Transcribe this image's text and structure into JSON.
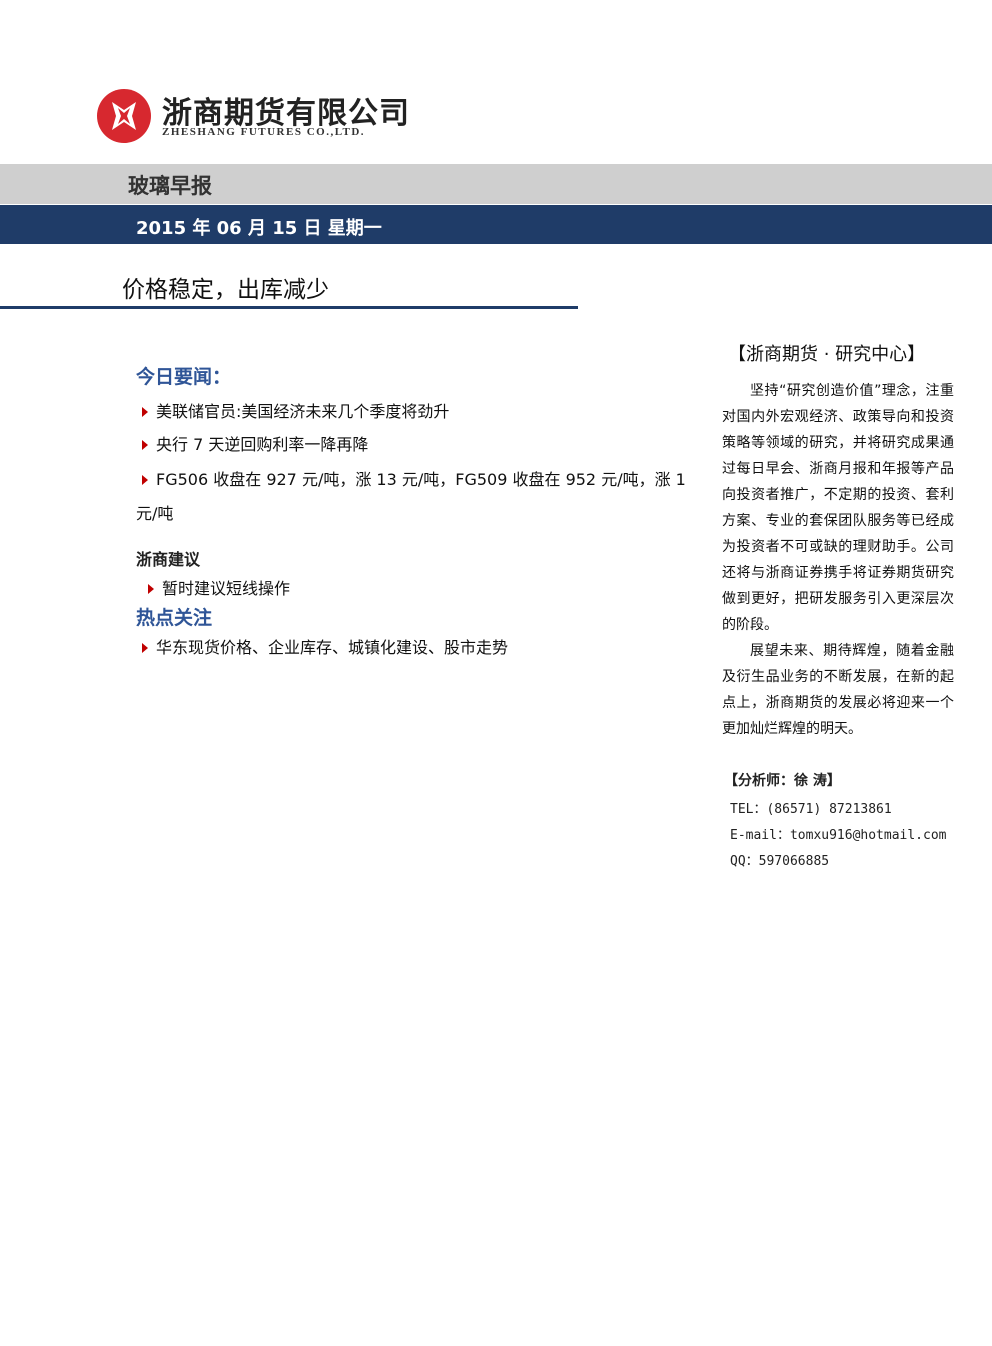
{
  "brand": {
    "name_cn": "浙商期货有限公司",
    "name_en": "ZHESHANG FUTURES CO.,LTD.",
    "colors": {
      "logo_red": "#d7282f",
      "navy": "#1f3c68",
      "heading_blue": "#2f5597"
    }
  },
  "report": {
    "title": "玻璃早报",
    "date": "2015 年 06 月 15 日  星期一",
    "headline": "价格稳定，出库减少"
  },
  "news": {
    "title": "今日要闻：",
    "items": [
      "美联储官员:美国经济未来几个季度将劲升",
      "央行 7 天逆回购利率一降再降",
      "FG506 收盘在 927 元/吨，涨 13 元/吨，FG509 收盘在 952 元/吨，涨 1",
      "元/吨"
    ]
  },
  "advice": {
    "title": "浙商建议",
    "items": [
      "暂时建议短线操作"
    ]
  },
  "focus": {
    "title": "热点关注",
    "items": [
      "华东现货价格、企业库存、城镇化建设、股市走势"
    ]
  },
  "sidebar": {
    "title": "【浙商期货 · 研究中心】",
    "para1": "坚持“研究创造价值”理念，注重对国内外宏观经济、政策导向和投资策略等领域的研究，并将研究成果通过每日早会、浙商月报和年报等产品向投资者推广，不定期的投资、套利方案、专业的套保团队服务等已经成为投资者不可或缺的理财助手。公司还将与浙商证券携手将证券期货研究做到更好，把研发服务引入更深层次的阶段。",
    "para2": "展望未来、期待辉煌，随着金融及衍生品业务的不断发展，在新的起点上，浙商期货的发展必将迎来一个更加灿烂辉煌的明天。",
    "analyst_label": "【分析师：徐  涛】",
    "tel": "TEL：(86571) 87213861",
    "email": "E-mail：tomxu916@hotmail.com",
    "qq": "QQ：597066885"
  }
}
